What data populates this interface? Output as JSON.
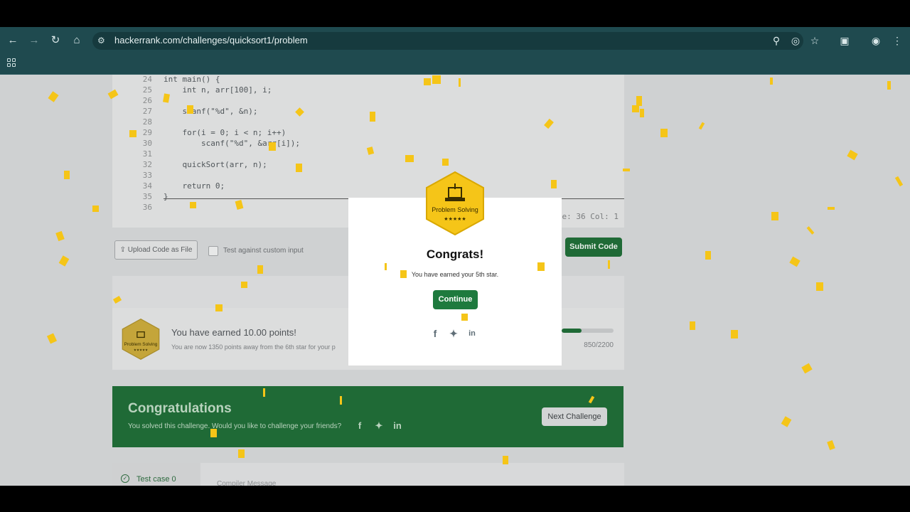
{
  "browser": {
    "url": "hackerrank.com/challenges/quicksort1/problem"
  },
  "editor": {
    "lines": [
      {
        "num": "24",
        "code": "int main() {"
      },
      {
        "num": "25",
        "code": "    int n, arr[100], i;"
      },
      {
        "num": "26",
        "code": ""
      },
      {
        "num": "27",
        "code": "    scanf(\"%d\", &n);"
      },
      {
        "num": "28",
        "code": ""
      },
      {
        "num": "29",
        "code": "    for(i = 0; i < n; i++)"
      },
      {
        "num": "30",
        "code": "        scanf(\"%d\", &arr[i]);"
      },
      {
        "num": "31",
        "code": ""
      },
      {
        "num": "32",
        "code": "    quickSort(arr, n);"
      },
      {
        "num": "33",
        "code": ""
      },
      {
        "num": "34",
        "code": "    return 0;"
      },
      {
        "num": "35",
        "code": "}"
      },
      {
        "num": "36",
        "code": ""
      }
    ],
    "status": "Line: 36 Col: 1"
  },
  "actions": {
    "upload_label": "Upload Code as File",
    "custom_input_label": "Test against custom input",
    "submit_label": "Submit Code"
  },
  "points": {
    "badge_title": "Problem Solving",
    "badge_stars": "★★★★★",
    "title": "You have earned 10.00 points!",
    "subtitle": "You are now 1350 points away from the 6th star for your p",
    "progress_text": "850/2200",
    "progress_fraction": 0.3864
  },
  "banner": {
    "title": "Congratulations",
    "subtitle": "You solved this challenge. Would you like to challenge your friends?",
    "next_label": "Next Challenge"
  },
  "tests": {
    "tab_label": "Test case 0",
    "compiler_label": "Compiler Message"
  },
  "modal": {
    "badge_title": "Problem Solving",
    "badge_stars": "★★★★★",
    "title": "Congrats!",
    "text": "You have earned your 5th star.",
    "continue_label": "Continue"
  },
  "colors": {
    "brand_green": "#1e7a3e",
    "confetti": "#f5c518",
    "badge_gold": "#f5c518"
  }
}
